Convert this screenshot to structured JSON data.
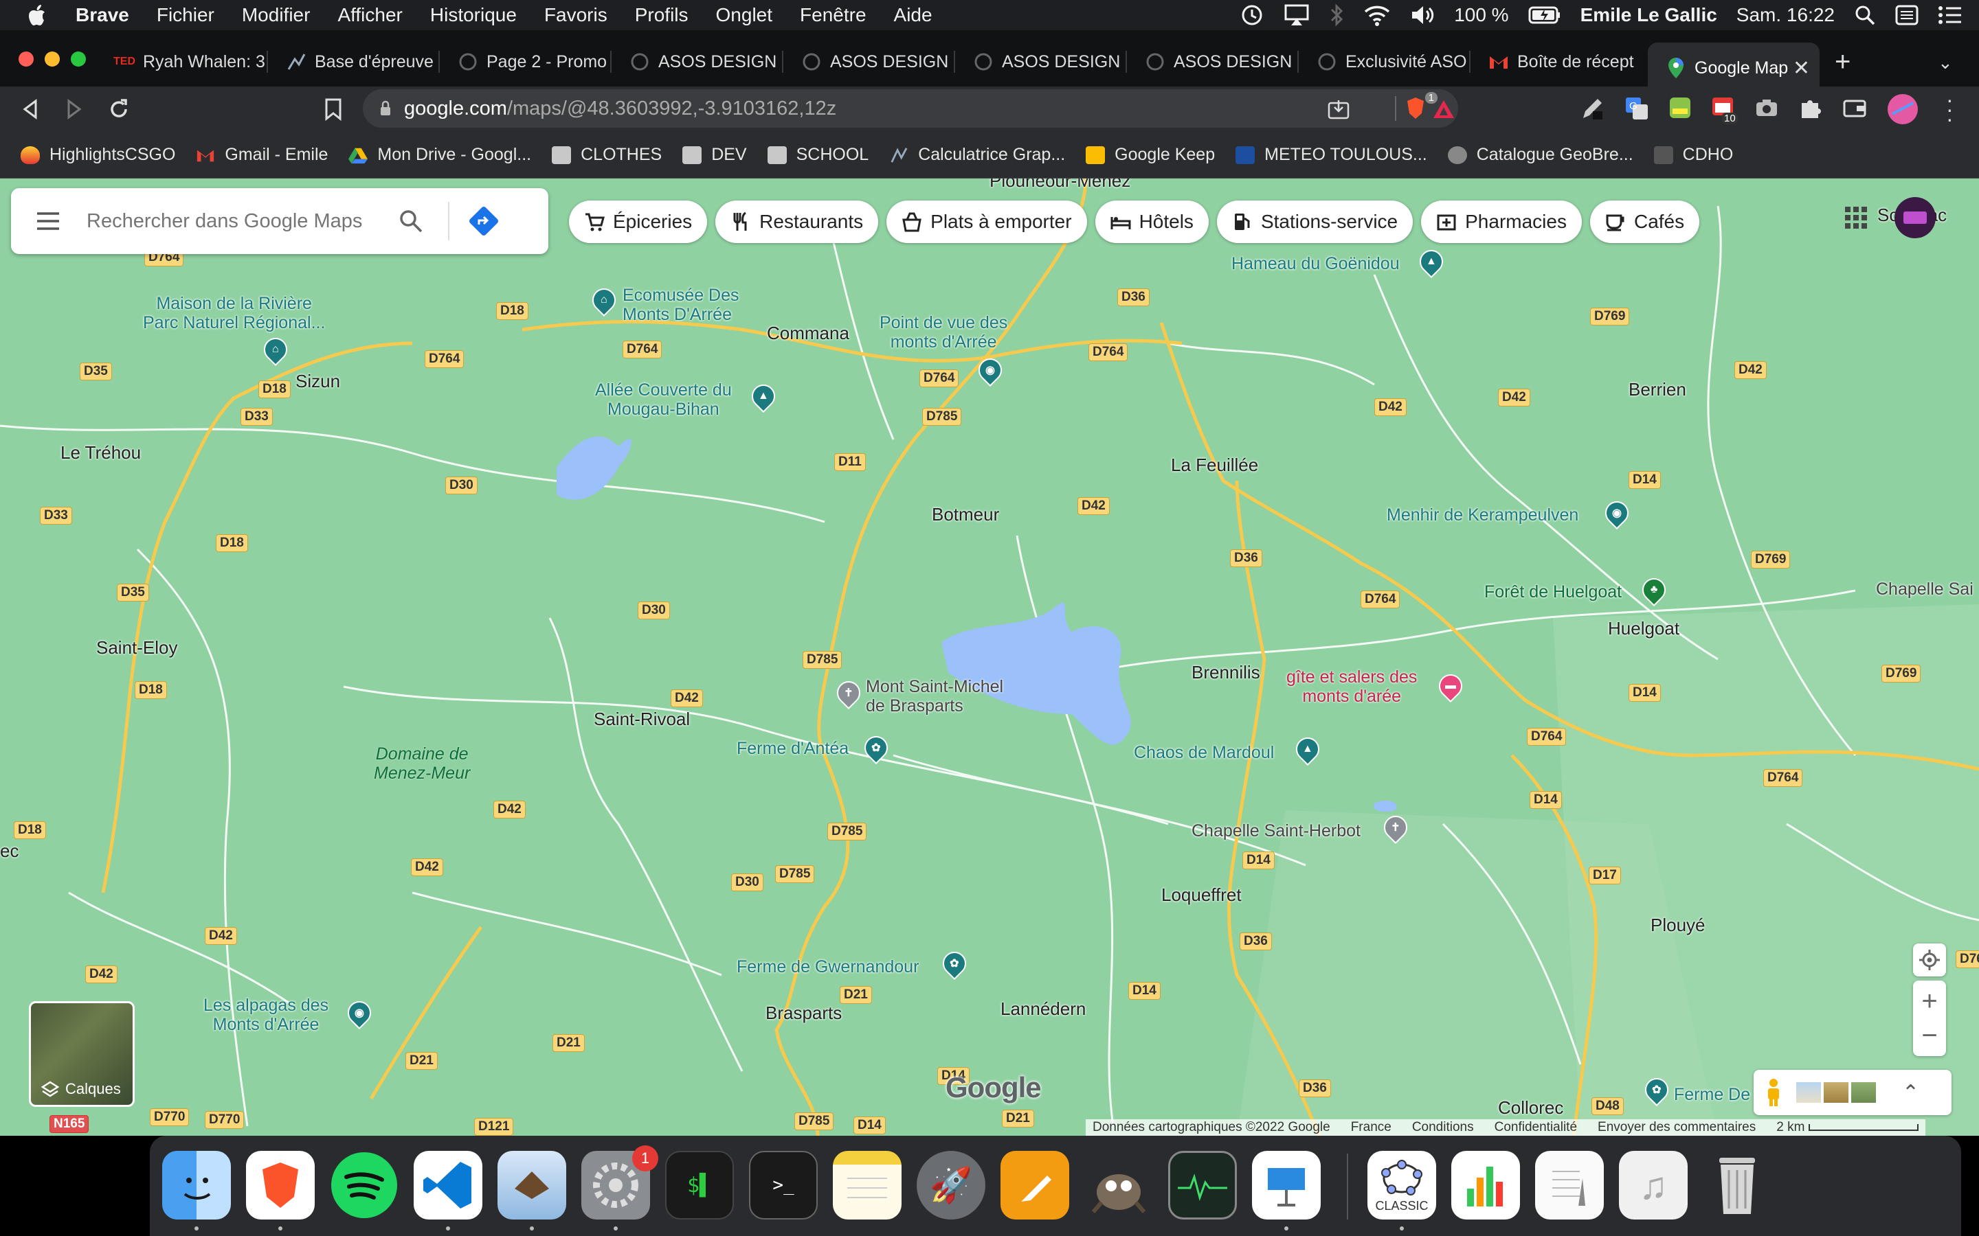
{
  "menubar": {
    "app": "Brave",
    "items": [
      "Fichier",
      "Modifier",
      "Afficher",
      "Historique",
      "Favoris",
      "Profils",
      "Onglet",
      "Fenêtre",
      "Aide"
    ],
    "battery": "100 %",
    "user": "Emile Le Gallic",
    "time": "Sam. 16:22"
  },
  "tabs": [
    {
      "label": "Ryah Whalen: 3",
      "icon": "ted-icon"
    },
    {
      "label": "Base d'épreuve",
      "icon": "graph-icon"
    },
    {
      "label": "Page 2 - Promo",
      "icon": "asos-icon"
    },
    {
      "label": "ASOS DESIGN",
      "icon": "asos-icon"
    },
    {
      "label": "ASOS DESIGN",
      "icon": "asos-icon"
    },
    {
      "label": "ASOS DESIGN",
      "icon": "asos-icon"
    },
    {
      "label": "ASOS DESIGN",
      "icon": "asos-icon"
    },
    {
      "label": "Exclusivité ASO",
      "icon": "asos-icon"
    },
    {
      "label": "Boîte de récept",
      "icon": "gmail-icon"
    },
    {
      "label": "Google Map",
      "icon": "maps-icon"
    }
  ],
  "url": {
    "host": "google.com",
    "path": "/maps/@48.3603992,-3.9103162,12z"
  },
  "extensions": {
    "brave_shield_count": "1",
    "calendar_badge": "10"
  },
  "bookmarks": [
    "HighlightsCSGO",
    "Gmail - Emile",
    "Mon Drive - Googl...",
    "CLOTHES",
    "DEV",
    "SCHOOL",
    "Calculatrice Grap...",
    "Google Keep",
    "METEO TOULOUS...",
    "Catalogue GeoBre...",
    "CDHO"
  ],
  "search": {
    "placeholder": "Rechercher dans Google Maps"
  },
  "chips": [
    "Épiceries",
    "Restaurants",
    "Plats à emporter",
    "Hôtels",
    "Stations-service",
    "Pharmacies",
    "Cafés"
  ],
  "places": [
    "Plouneour-Ménez",
    "Commana",
    "Sizun",
    "Le Tréhou",
    "Berrien",
    "La Feuillée",
    "Botmeur",
    "Saint-Eloy",
    "Huelgoat",
    "Brennilis",
    "Saint-Rivoal",
    "Loqueffret",
    "Plouyé",
    "Brasparts",
    "Lannédern",
    "Collorec",
    "Scrignac",
    "ec",
    "Chapelle Sai"
  ],
  "roads": [
    "D764",
    "D18",
    "D764",
    "D36",
    "D769",
    "D35",
    "D764",
    "D18",
    "D764",
    "D764",
    "D42",
    "D42",
    "D33",
    "D785",
    "D42",
    "D30",
    "D11",
    "D14",
    "D33",
    "D18",
    "D42",
    "D36",
    "D769",
    "D35",
    "D30",
    "D764",
    "D785",
    "D42",
    "D18",
    "D14",
    "D769",
    "D764",
    "D42",
    "D785",
    "D764",
    "D18",
    "D14",
    "D17",
    "D42",
    "D30",
    "D785",
    "D42",
    "D14",
    "D36",
    "D42",
    "D21",
    "D14",
    "D764",
    "D21",
    "D21",
    "D36",
    "D48",
    "D770",
    "D770",
    "D121",
    "D785",
    "D14",
    "D21",
    "D14",
    "N165"
  ],
  "pois": [
    {
      "name": "Maison de la Rivière\nParc Naturel Régional...",
      "type": "museum"
    },
    {
      "name": "Ecomusée Des\nMonts D'Arrée",
      "type": "museum"
    },
    {
      "name": "Point de vue des\nmonts d'Arrée",
      "type": "camera"
    },
    {
      "name": "Hameau du Goënidou",
      "type": "landmark"
    },
    {
      "name": "Allée Couverte du\nMougau-Bihan",
      "type": "landmark"
    },
    {
      "name": "Menhir de Kerampeulven",
      "type": "camera"
    },
    {
      "name": "Forêt de Huelgoat",
      "type": "tree"
    },
    {
      "name": "gîte et salers des\nmonts d'arée",
      "type": "hotel"
    },
    {
      "name": "Mont Saint-Michel\nde Brasparts",
      "type": "church"
    },
    {
      "name": "Ferme d'Antéa",
      "type": "farm"
    },
    {
      "name": "Chaos de Mardoul",
      "type": "landmark"
    },
    {
      "name": "Chapelle Saint-Herbot",
      "type": "church"
    },
    {
      "name": "Ferme de Gwernandour",
      "type": "farm"
    },
    {
      "name": "Les alpagas des\nMonts d'Arrée",
      "type": "camera"
    },
    {
      "name": "Ferme De",
      "type": "farm"
    },
    {
      "name": "Domaine de\nMenez-Meur",
      "type": "park"
    }
  ],
  "layers_label": "Calques",
  "footer": [
    "Données cartographiques ©2022 Google",
    "France",
    "Conditions",
    "Confidentialité",
    "Envoyer des commentaires",
    "2 km"
  ],
  "google_logo": "Google",
  "dock": {
    "badge": "1",
    "keynote_label": "CLASSIC",
    "apps": [
      "finder",
      "brave",
      "spotify",
      "vscode",
      "mail",
      "system-preferences",
      "terminal-green",
      "terminal",
      "notes",
      "rocket",
      "pages",
      "gimp",
      "activity-monitor",
      "keynote",
      "geogebra-classic",
      "numbers",
      "textedit",
      "music",
      "trash"
    ]
  },
  "colors": {
    "map_bg": "#8fd1a1",
    "water": "#9cc0f9",
    "road_yellow": "#f8d67a",
    "poi_teal": "#1b7a7d",
    "poi_red": "#c4244d"
  }
}
